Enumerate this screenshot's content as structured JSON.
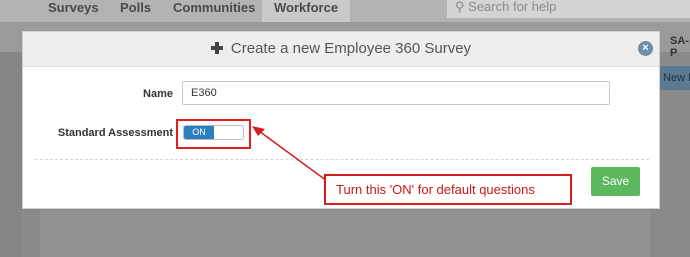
{
  "nav": {
    "items": [
      "Surveys",
      "Polls",
      "Communities",
      "Workforce"
    ],
    "active": "Workforce",
    "search_placeholder": "Search for help"
  },
  "background": {
    "right_text": "SA-P",
    "right_button": "New Em"
  },
  "modal": {
    "title": "Create a new Employee 360 Survey",
    "close_glyph": "×",
    "name_label": "Name",
    "name_value": "E360",
    "standard_assessment_label": "Standard Assessment",
    "toggle_state": "ON",
    "save_label": "Save"
  },
  "annotation": {
    "callout_text": "Turn this 'ON' for default questions",
    "color": "#d41e1e"
  }
}
